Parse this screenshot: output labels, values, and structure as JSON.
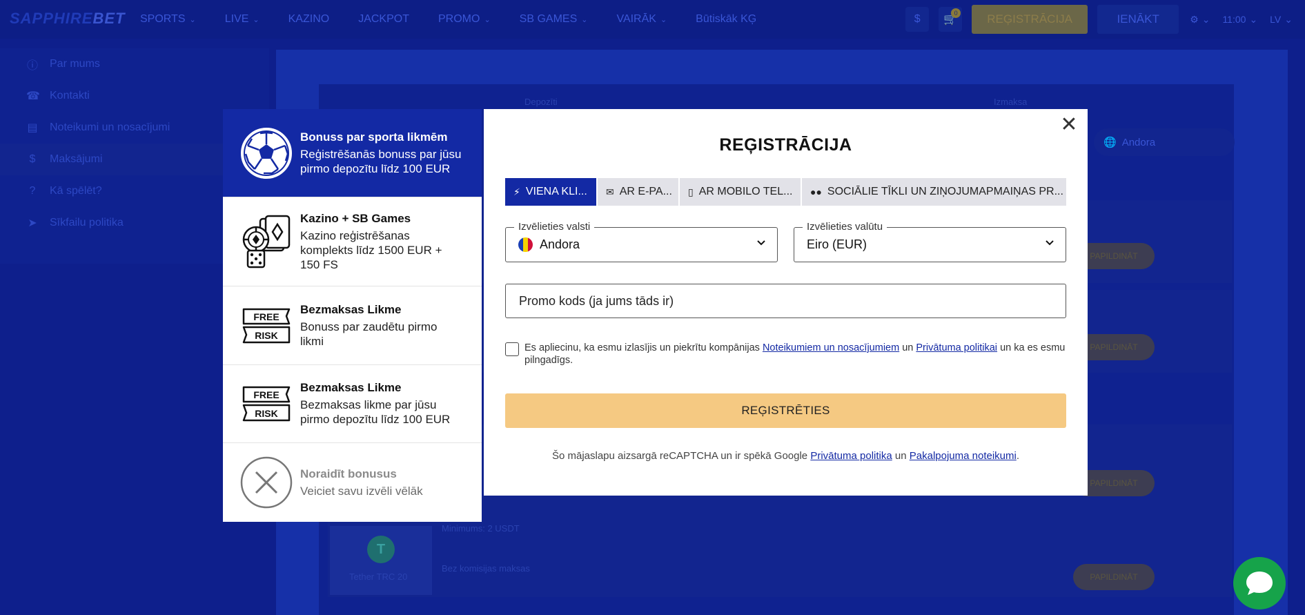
{
  "header": {
    "logo": {
      "main": "SAPPHIRE",
      "accent": "BET"
    },
    "nav": [
      {
        "label": "SPORTS",
        "chevron": true
      },
      {
        "label": "LIVE",
        "chevron": true
      },
      {
        "label": "KAZINO",
        "chevron": false
      },
      {
        "label": "JACKPOT",
        "chevron": false
      },
      {
        "label": "PROMO",
        "chevron": true
      },
      {
        "label": "SB GAMES",
        "chevron": true
      },
      {
        "label": "VAIRĀK",
        "chevron": true
      },
      {
        "label": "Būtiskāk KĢ",
        "chevron": false
      }
    ],
    "cart_count": "0",
    "register_label": "REĢISTRĀCIJA",
    "login_label": "IENĀKT",
    "time": "11:00",
    "lang": "LV"
  },
  "sidebar": {
    "items": [
      {
        "label": "Par mums",
        "icon": "info-icon"
      },
      {
        "label": "Kontakti",
        "icon": "phone-icon"
      },
      {
        "label": "Noteikumi un nosacījumi",
        "icon": "document-icon"
      },
      {
        "label": "Maksājumi",
        "icon": "dollar-icon"
      },
      {
        "label": "Kā spēlēt?",
        "icon": "question-icon"
      },
      {
        "label": "Sīkfailu politika",
        "icon": "cookie-icon"
      }
    ]
  },
  "background": {
    "deposit_label": "Depozīti",
    "withdraw_label": "Izmaksa",
    "country": "Andora",
    "pay_btn": "PAPILDINĀT",
    "tether_label": "Tether TRC 20",
    "min_text": "Minimums: 2 USDT",
    "fee_text": "Bez komisijas maksas"
  },
  "bonus_panel": {
    "items": [
      {
        "title": "Bonuss par sporta likmēm",
        "desc": "Reģistrēšanās bonuss par jūsu pirmo depozītu līdz 100 EUR",
        "icon": "soccer-ball-icon"
      },
      {
        "title": "Kazino + SB Games",
        "desc": "Kazino reģistrēšanas komplekts līdz 1500 EUR + 150 FS",
        "icon": "casino-cards-icon"
      },
      {
        "title": "Bezmaksas Likme",
        "desc": "Bonuss par zaudētu pirmo likmi",
        "icon": "free-risk-icon"
      },
      {
        "title": "Bezmaksas Likme",
        "desc": "Bezmaksas likme par jūsu pirmo depozītu līdz 100 EUR",
        "icon": "free-risk-icon"
      },
      {
        "title": "Noraidīt bonusus",
        "desc": "Veiciet savu izvēli vēlāk",
        "icon": "reject-icon"
      }
    ],
    "free_label": "FREE",
    "risk_label": "RISK"
  },
  "modal": {
    "title": "REĢISTRĀCIJA",
    "tabs": [
      {
        "label": "VIENA KLI...",
        "icon": "lightning-icon"
      },
      {
        "label": "AR E-PA...",
        "icon": "envelope-icon"
      },
      {
        "label": "AR MOBILO TEL...",
        "icon": "mobile-icon"
      },
      {
        "label": "SOCIĀLIE TĪKLI UN ZIŅOJUMAPMAIŅAS PR...",
        "icon": "users-icon"
      }
    ],
    "country_legend": "Izvēlieties valsti",
    "country_value": "Andora",
    "currency_legend": "Izvēlieties valūtu",
    "currency_value": "Eiro (EUR)",
    "promo_placeholder": "Promo kods (ja jums tāds ir)",
    "terms": {
      "pre": "Es apliecinu, ka esmu izlasījis un piekrītu kompānijas ",
      "link1": "Noteikumiem un nosacījumiem",
      "mid": " un ",
      "link2": "Privātuma politikai",
      "post": " un ka es esmu pilngadīgs."
    },
    "register_button": "REĢISTRĒTIES",
    "recaptcha": {
      "pre": "Šo mājaslapu aizsargā reCAPTCHA un ir spēkā Google ",
      "link1": "Privātuma politika",
      "mid": " un ",
      "link2": "Pakalpojuma noteikumi",
      "post": "."
    }
  },
  "colors": {
    "brand_blue": "#1329a4",
    "register_yellow": "#f5c982",
    "chat_green": "#16a34a"
  }
}
